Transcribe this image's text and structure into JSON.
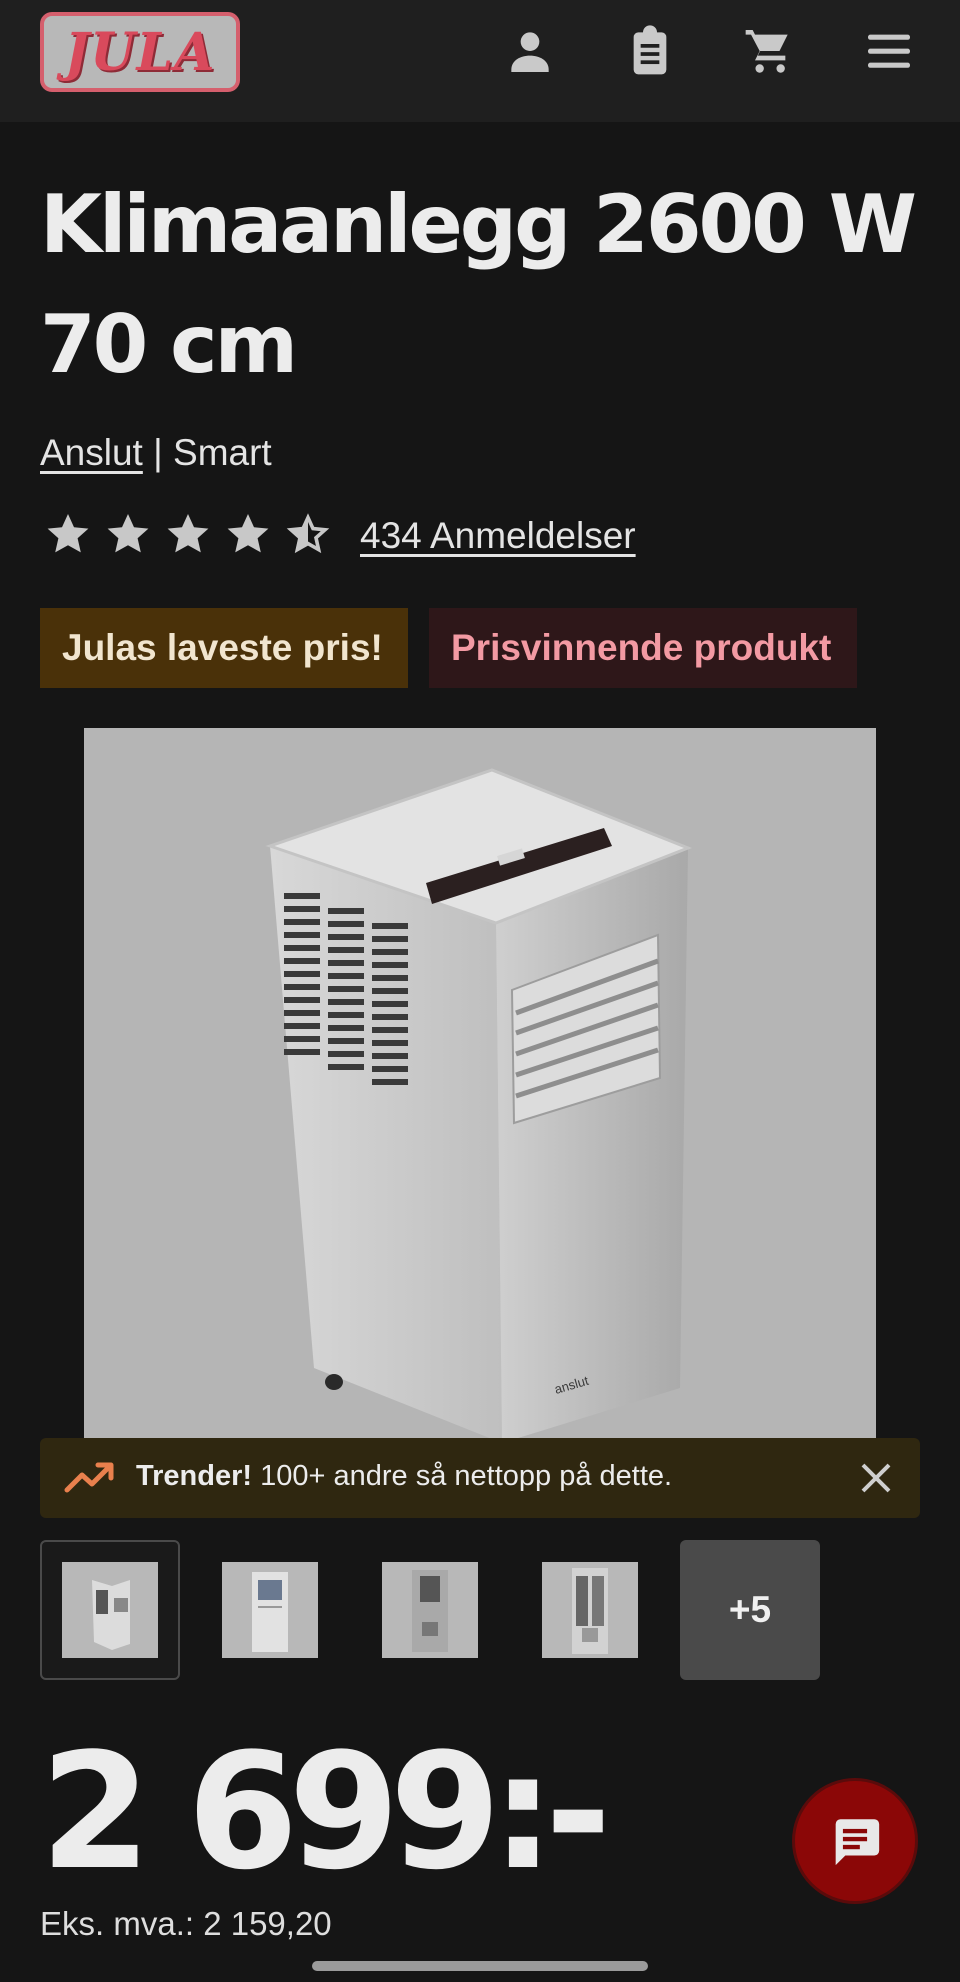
{
  "header": {
    "logo_text": "JULA",
    "icons": [
      "person-icon",
      "clipboard-icon",
      "cart-icon",
      "menu-icon"
    ]
  },
  "product": {
    "title": "Klimaanlegg 2600 W 70 cm",
    "brand_link": "Anslut",
    "separator": " | ",
    "brand_line": "Smart",
    "rating": 4.5,
    "reviews_label": "434 Anmeldelser",
    "badges": [
      "Julas laveste pris!",
      "Prisvinnende produkt"
    ],
    "image_brand_text": "anslut"
  },
  "trend_banner": {
    "strong": "Trender!",
    "text": " 100+ andre så nettopp på dette."
  },
  "thumbnails": {
    "more_label": "+5"
  },
  "price": {
    "main": "2 699:-",
    "ex_vat": "Eks. mva.: 2 159,20"
  },
  "colors": {
    "background": "#151515",
    "logo_red": "#d94a5c",
    "badge_lowest": "#4a3109",
    "badge_award": "#2e1719",
    "chat_button": "#8b0707"
  }
}
